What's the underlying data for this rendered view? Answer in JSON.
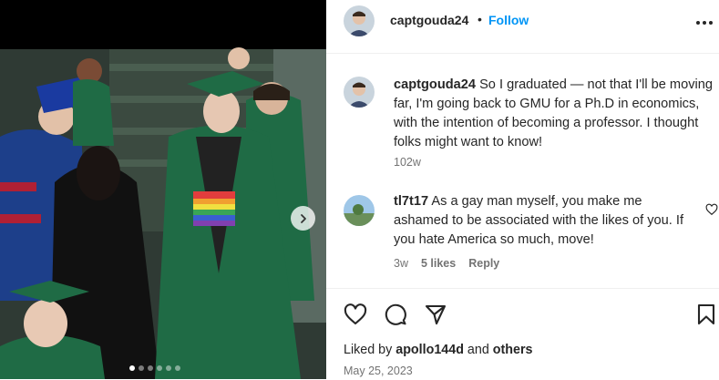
{
  "post": {
    "author": "captgouda24",
    "separator": "•",
    "follow_label": "Follow",
    "caption_user": "captgouda24",
    "caption_text": "So I graduated — not that I'll be moving far, I'm going back to GMU for a Ph.D in economics, with the intention of becoming a professor. I thought folks might want to know!",
    "caption_age": "102w"
  },
  "comments": [
    {
      "user": "tl7t17",
      "text": "As a gay man myself, you make me ashamed to be associated with the likes of you. If you hate America so much, move!",
      "age": "3w",
      "likes": "5 likes",
      "reply_label": "Reply"
    }
  ],
  "likes": {
    "prefix": "Liked by",
    "user": "apollo144d",
    "joiner": "and",
    "others": "others"
  },
  "date": "May 25, 2023",
  "carousel": {
    "count": 6,
    "active_index": 0
  },
  "icons": [
    "more-icon",
    "heart-icon",
    "comment-icon",
    "share-icon",
    "bookmark-icon",
    "chevron-right-icon",
    "heart-small-icon"
  ],
  "colors": {
    "accent": "#0095f6",
    "gown": "#1f6b45",
    "secondary_text": "#737373"
  }
}
